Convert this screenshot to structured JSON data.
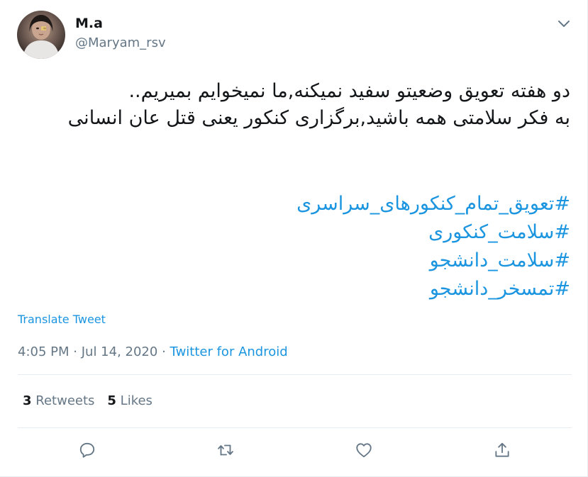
{
  "author": {
    "display_name": "M.a",
    "username": "@Maryam_rsv"
  },
  "tweet": {
    "text": "دو هفته تعویق وضعیتو سفید نمیکنه,ما نمیخوایم بمیریم..\nبه فکر سلامتی همه باشید,برگزاری کنکور یعنی قتل عان انسانی",
    "hashtags": [
      "#تعویق_تمام_کنکورهای_سراسری",
      "#سلامت_کنکوری",
      "#سلامت_دانشجو",
      "#تمسخر_دانشجو"
    ],
    "translate_label": "Translate Tweet",
    "time": "4:05 PM",
    "separator": "·",
    "date": "Jul 14, 2020",
    "source": "Twitter for Android"
  },
  "stats": {
    "retweets_count": "3",
    "retweets_label": "Retweets",
    "likes_count": "5",
    "likes_label": "Likes"
  },
  "icons": {
    "reply": "reply-icon",
    "retweet": "retweet-icon",
    "like": "heart-icon",
    "share": "share-icon",
    "caret": "chevron-down-icon"
  },
  "colors": {
    "link": "#1b95e0",
    "muted": "#657786",
    "text": "#14171a",
    "border": "#e6ecf0"
  }
}
